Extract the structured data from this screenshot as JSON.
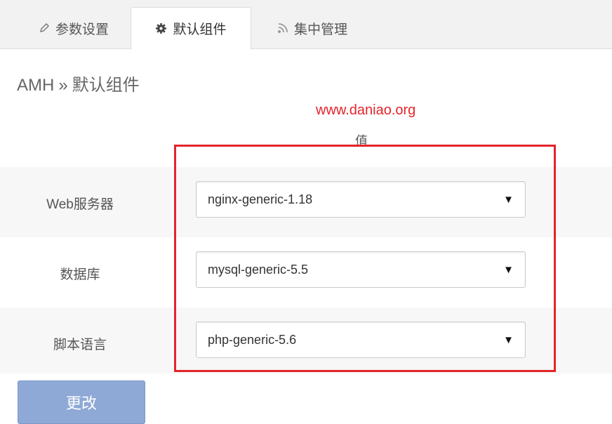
{
  "tabs": [
    {
      "label": "参数设置",
      "icon": "pencil-icon"
    },
    {
      "label": "默认组件",
      "icon": "gear-icon"
    },
    {
      "label": "集中管理",
      "icon": "rss-icon"
    }
  ],
  "breadcrumb": {
    "root": "AMH",
    "separator": "»",
    "current": "默认组件"
  },
  "watermark": "www.daniao.org",
  "table": {
    "value_header": "值",
    "rows": [
      {
        "label": "Web服务器",
        "value": "nginx-generic-1.18"
      },
      {
        "label": "数据库",
        "value": "mysql-generic-5.5"
      },
      {
        "label": "脚本语言",
        "value": "php-generic-5.6"
      }
    ]
  },
  "submit_label": "更改",
  "colors": {
    "highlight": "#e3242b",
    "button": "#8fa9d6"
  }
}
